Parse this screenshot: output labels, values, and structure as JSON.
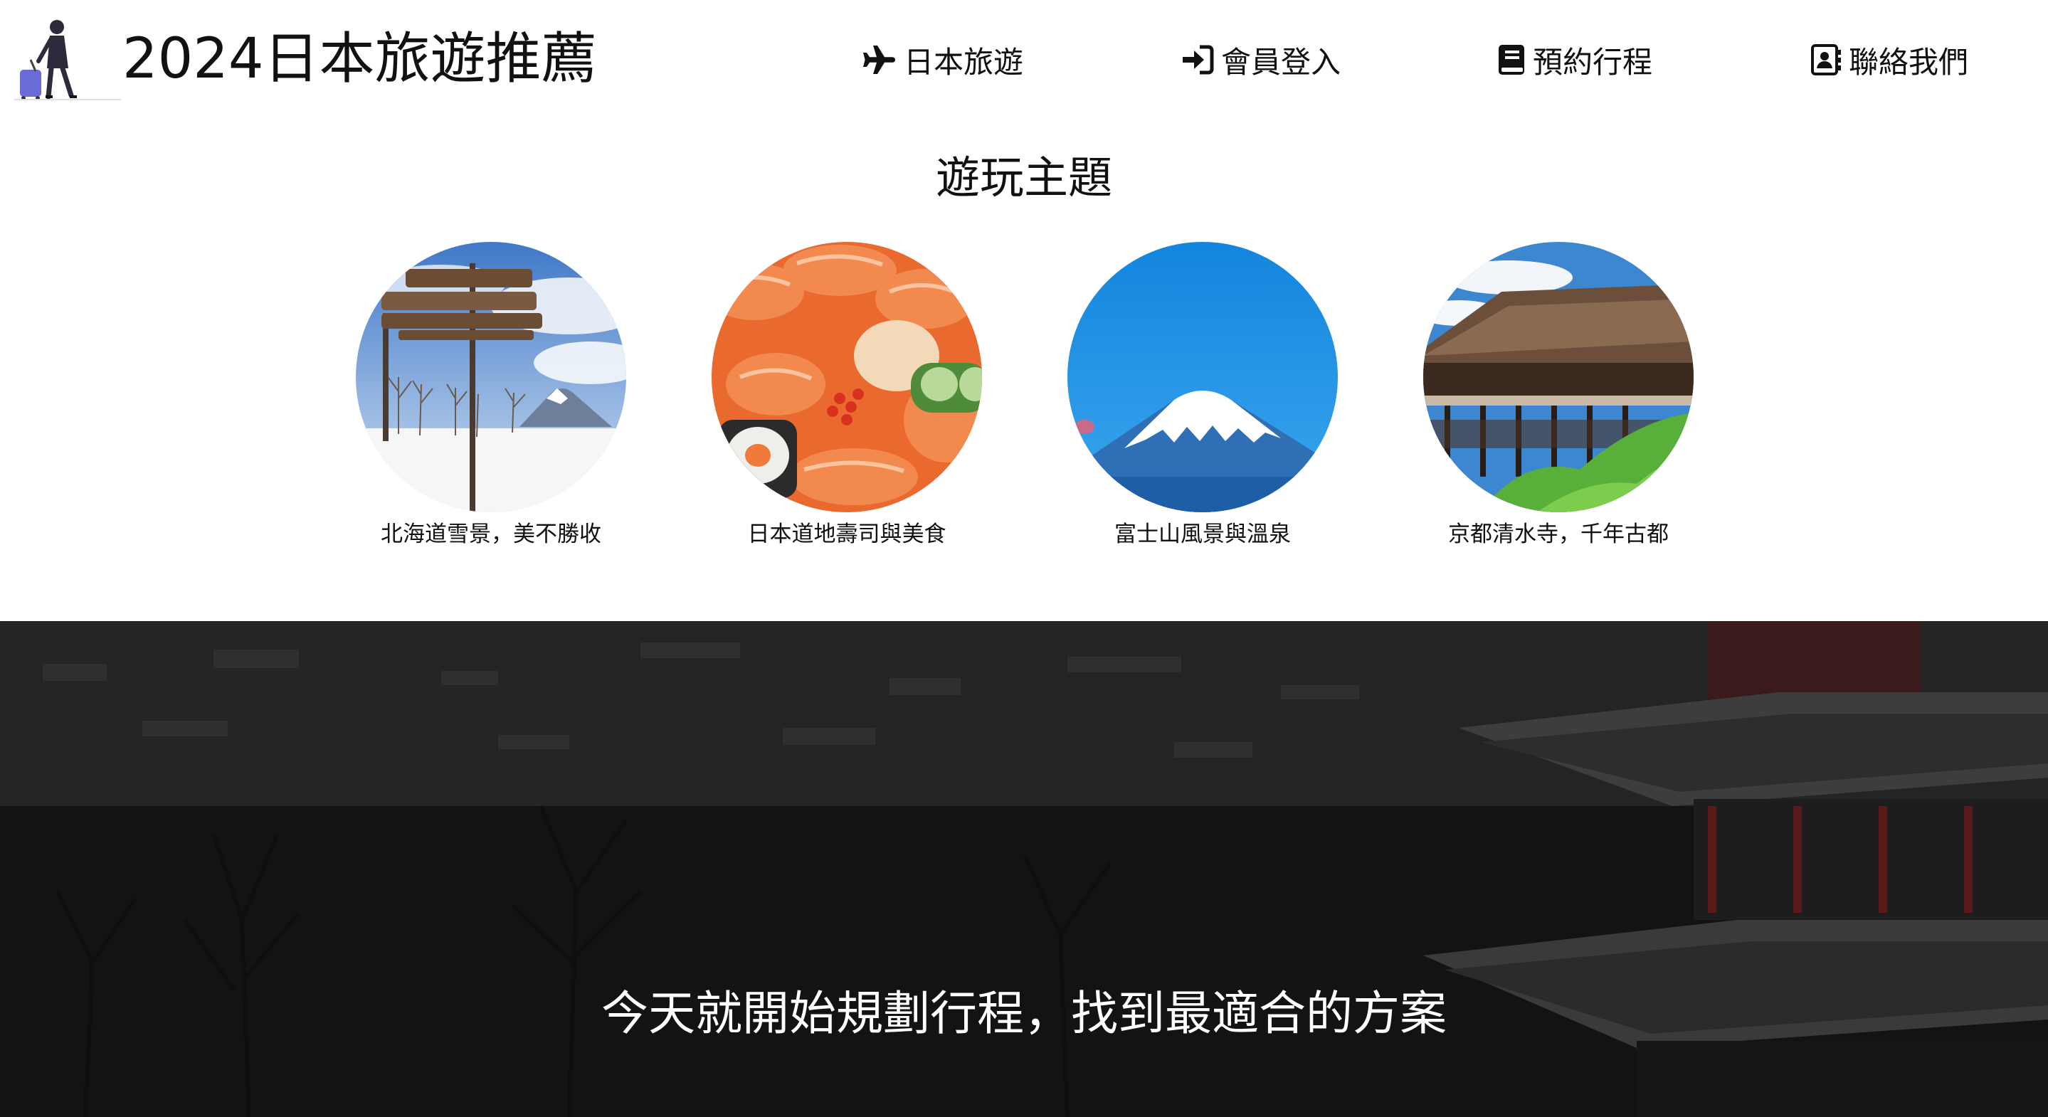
{
  "header": {
    "title": "2024日本旅遊推薦",
    "logo_icon": "traveler-with-suitcase-icon"
  },
  "nav": [
    {
      "label": "日本旅遊",
      "icon": "plane-icon"
    },
    {
      "label": "會員登入",
      "icon": "sign-in-icon"
    },
    {
      "label": "預約行程",
      "icon": "book-icon"
    },
    {
      "label": "聯絡我們",
      "icon": "contact-card-icon"
    }
  ],
  "themes": {
    "title": "遊玩主題",
    "items": [
      {
        "caption": "北海道雪景，美不勝收",
        "image": "hokkaido-snow-signpost-image"
      },
      {
        "caption": "日本道地壽司與美食",
        "image": "sushi-platter-image"
      },
      {
        "caption": "富士山風景與溫泉",
        "image": "mount-fuji-image"
      },
      {
        "caption": "京都清水寺，千年古都",
        "image": "kiyomizu-dera-temple-image"
      }
    ]
  },
  "banner": {
    "text": "今天就開始規劃行程，找到最適合的方案",
    "image": "city-view-with-pagoda-image"
  },
  "colors": {
    "text": "#111111",
    "banner_bg": "#161616",
    "banner_text": "#ffffff"
  }
}
